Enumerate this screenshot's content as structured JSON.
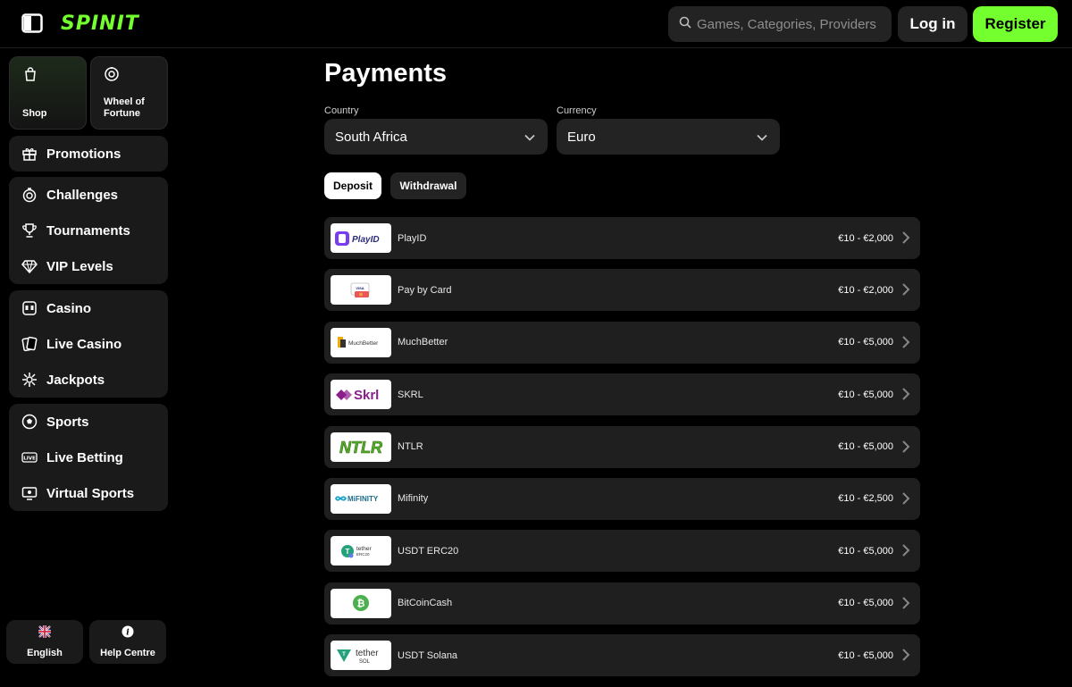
{
  "header": {
    "logo_text": "SPINIT",
    "search_placeholder": "Games, Categories, Providers",
    "login_label": "Log in",
    "register_label": "Register"
  },
  "sidebar": {
    "tiles": [
      {
        "label": "Shop",
        "icon": "shopping-bag-icon"
      },
      {
        "label_line1": "Wheel of",
        "label_line2": "Fortune",
        "icon": "wheel-icon"
      }
    ],
    "groups": [
      {
        "items": [
          {
            "label": "Promotions",
            "icon": "gift-icon"
          }
        ]
      },
      {
        "items": [
          {
            "label": "Challenges",
            "icon": "target-icon"
          },
          {
            "label": "Tournaments",
            "icon": "trophy-icon"
          },
          {
            "label": "VIP Levels",
            "icon": "diamond-icon"
          }
        ]
      },
      {
        "items": [
          {
            "label": "Casino",
            "icon": "slot-machine-icon"
          },
          {
            "label": "Live Casino",
            "icon": "cards-icon"
          },
          {
            "label": "Jackpots",
            "icon": "jackpot-icon"
          }
        ]
      },
      {
        "items": [
          {
            "label": "Sports",
            "icon": "soccer-ball-icon"
          },
          {
            "label": "Live Betting",
            "icon": "live-icon"
          },
          {
            "label": "Virtual Sports",
            "icon": "monitor-icon"
          }
        ]
      }
    ],
    "bottom": {
      "language_label": "English",
      "help_label": "Help Centre"
    }
  },
  "main": {
    "title": "Payments",
    "country_label": "Country",
    "country_value": "South Africa",
    "currency_label": "Currency",
    "currency_value": "Euro",
    "tabs": [
      {
        "label": "Deposit",
        "active": true
      },
      {
        "label": "Withdrawal",
        "active": false
      }
    ],
    "methods": [
      {
        "name": "PlayID",
        "range": "€10 - €2,000",
        "logo_text": "PlayID"
      },
      {
        "name": "Pay by Card",
        "range": "€10 - €2,000",
        "logo_text": "VISA"
      },
      {
        "name": "MuchBetter",
        "range": "€10 - €5,000",
        "logo_text": "MuchBetter"
      },
      {
        "name": "SKRL",
        "range": "€10 - €5,000",
        "logo_text": "Skrl"
      },
      {
        "name": "NTLR",
        "range": "€10 - €5,000",
        "logo_text": "NTLR"
      },
      {
        "name": "Mifinity",
        "range": "€10 - €2,500",
        "logo_text": "MiFINITY"
      },
      {
        "name": "USDT ERC20",
        "range": "€10 - €5,000",
        "logo_text": "tether",
        "logo_sub": "ERC20"
      },
      {
        "name": "BitCoinCash",
        "range": "€10 - €5,000",
        "logo_text": ""
      },
      {
        "name": "USDT Solana",
        "range": "€10 - €5,000",
        "logo_text": "tether",
        "logo_sub": "SOL"
      }
    ]
  },
  "colors": {
    "accent": "#74ff2f",
    "background": "#000000",
    "panel": "#1a1a1a"
  }
}
